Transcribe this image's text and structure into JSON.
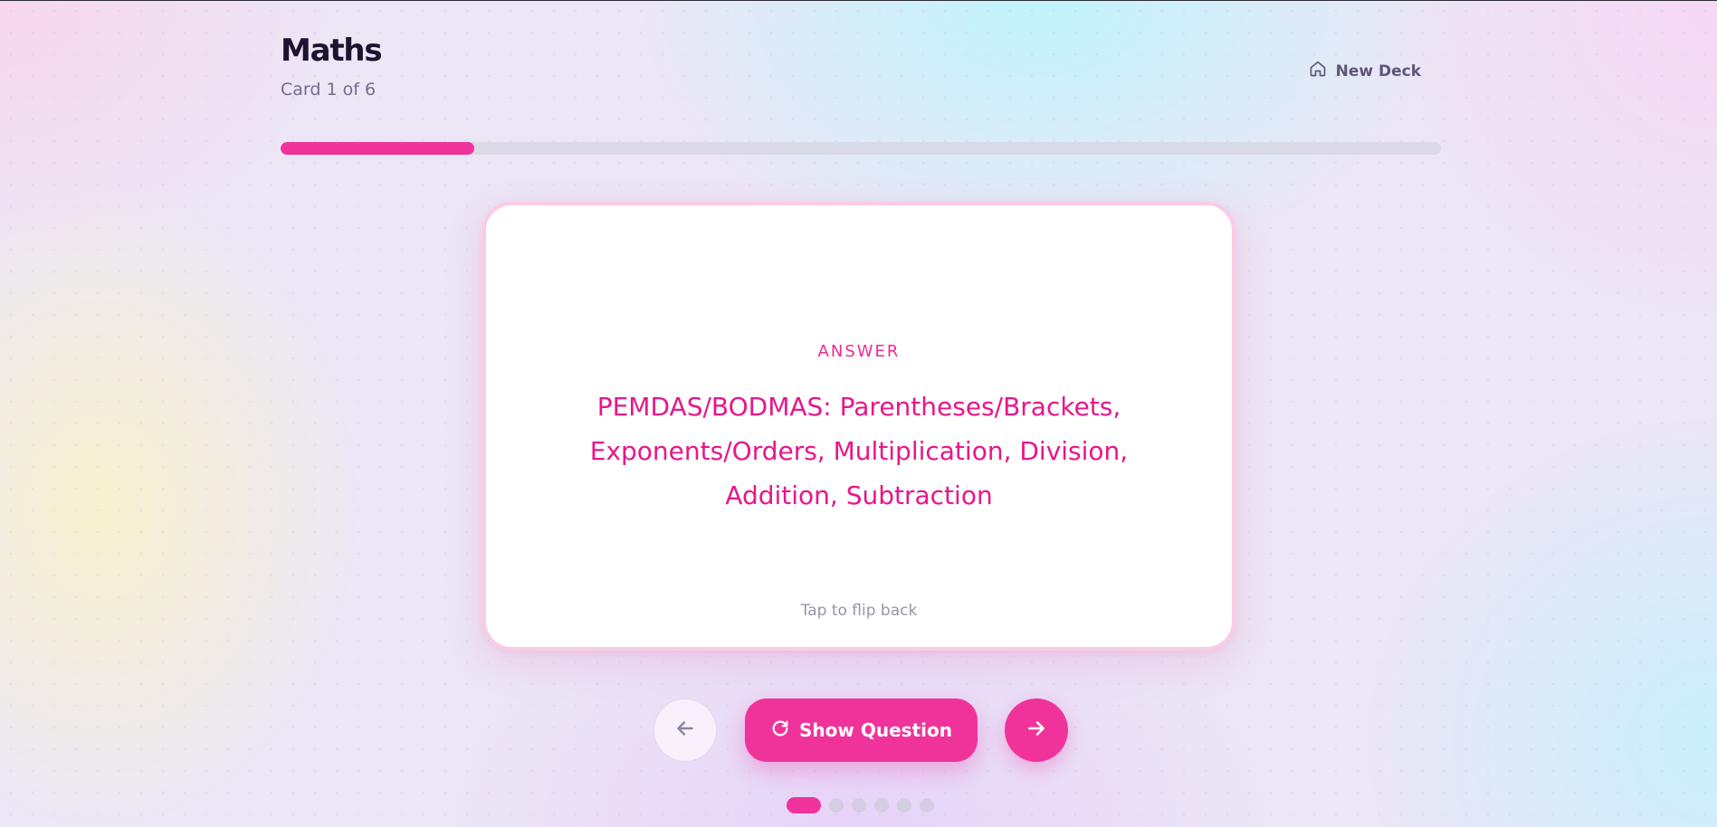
{
  "deck": {
    "title": "Maths",
    "card_counter": "Card 1 of 6",
    "new_deck_label": "New Deck"
  },
  "progress": {
    "current_card": 1,
    "total_cards": 6,
    "fraction": 0.1667
  },
  "card": {
    "side_label": "ANSWER",
    "text": "PEMDAS/BODMAS: Parentheses/Brackets, Exponents/Orders, Multiplication, Division, Addition, Subtraction",
    "hint": "Tap to flip back"
  },
  "controls": {
    "flip_label": "Show Question",
    "prev_icon": "arrow-left-icon",
    "next_icon": "arrow-right-icon",
    "flip_icon": "refresh-icon",
    "home_icon": "home-icon"
  },
  "pagination": {
    "count": 6,
    "active_index": 0
  },
  "colors": {
    "accent": "#f0339a",
    "answer_text": "#e7168a",
    "title_text": "#1e1330",
    "muted_text": "#756b8f"
  }
}
